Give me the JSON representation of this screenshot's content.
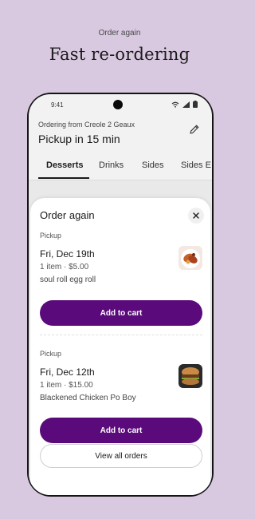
{
  "promo": {
    "eyebrow": "Order again",
    "title": "Fast re-ordering"
  },
  "status_bar": {
    "time": "9:41"
  },
  "header": {
    "subtitle": "Ordering from Creole 2 Geaux",
    "title": "Pickup in 15 min"
  },
  "tabs": [
    {
      "label": "Desserts",
      "active": true
    },
    {
      "label": "Drinks",
      "active": false
    },
    {
      "label": "Sides",
      "active": false
    },
    {
      "label": "Sides E",
      "active": false
    }
  ],
  "sheet": {
    "title": "Order again",
    "orders": [
      {
        "method": "Pickup",
        "date": "Fri, Dec 19th",
        "summary": "1 item · $5.00",
        "item": "soul roll egg roll",
        "image_icon": "food-photo-egg-roll",
        "button": "Add to cart"
      },
      {
        "method": "Pickup",
        "date": "Fri, Dec 12th",
        "summary": "1 item · $15.00",
        "item": "Blackened Chicken Po Boy",
        "image_icon": "food-photo-po-boy",
        "button": "Add to cart"
      }
    ],
    "view_all": "View all orders"
  },
  "colors": {
    "background": "#d8c8e0",
    "accent": "#5a0a7a"
  }
}
